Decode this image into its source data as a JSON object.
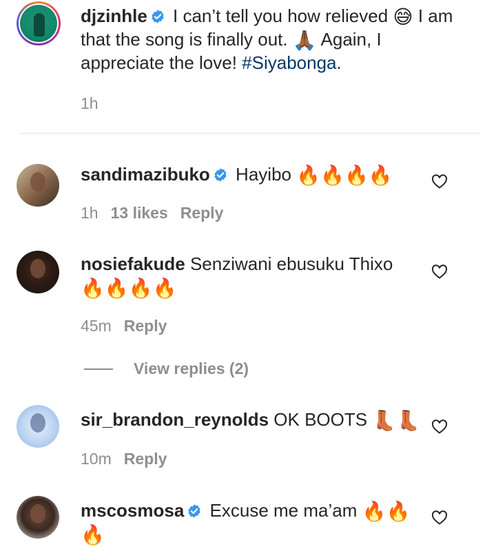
{
  "caption": {
    "username": "djzinhle",
    "text_before_emoji": " I can’t tell you how relieved ",
    "emoji1": "😅",
    "text_middle": " I am that the song is finally out. ",
    "emoji2": "🙏🏾",
    "text_after": " Again, I appreciate the love! ",
    "hashtag": "#Siyabonga",
    "end": ".",
    "time": "1h"
  },
  "comments": [
    {
      "username": "sandimazibuko",
      "verified": true,
      "text": " Hayibo ",
      "emoji": "🔥🔥🔥🔥",
      "time": "1h",
      "likes": "13 likes",
      "reply": "Reply"
    },
    {
      "username": "nosiefakude",
      "verified": false,
      "text": " Senziwani ebusuku Thixo",
      "emoji": "🔥🔥🔥🔥",
      "time": "45m",
      "reply": "Reply",
      "view_replies": "View replies (2)"
    },
    {
      "username": "sir_brandon_reynolds",
      "verified": false,
      "text": " OK BOOTS ",
      "emoji": "👢👢",
      "time": "10m",
      "reply": "Reply"
    },
    {
      "username": "mscosmosa",
      "verified": true,
      "text": " Excuse me ma’am ",
      "emoji": "🔥🔥",
      "emoji_line2": "🔥"
    }
  ],
  "colors": {
    "text": "#262626",
    "secondary": "#8e8e8e",
    "hashtag": "#00376b",
    "verified": "#3897f0"
  },
  "icons": {
    "heart": "heart-outline-icon",
    "verified": "verified-badge-icon"
  }
}
